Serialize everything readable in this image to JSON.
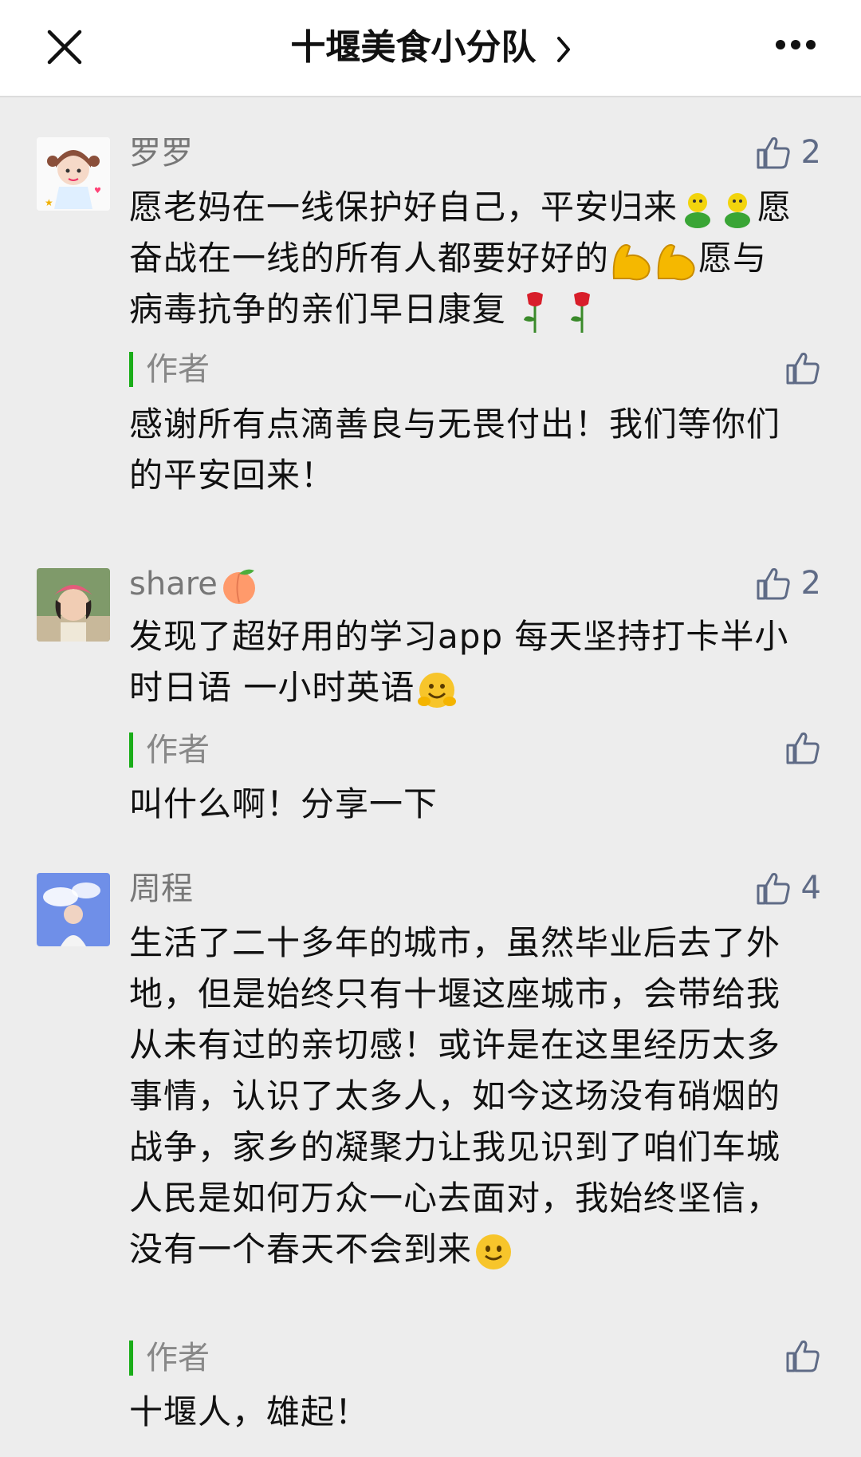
{
  "nav": {
    "title": "十堰美食小分队",
    "close_icon": "close-icon",
    "more_icon": "more-icon"
  },
  "comments": [
    {
      "nickname": "罗罗",
      "likes": "2",
      "text_segments": [
        "愿老妈在一线保护好自己，平安归来",
        "愿奋战在一线的所有人都要好好的",
        "愿与病毒抗争的亲们早日康复"
      ],
      "reply_label": "作者",
      "reply": "感谢所有点滴善良与无畏付出！我们等你们的平安回来！"
    },
    {
      "nickname": "share",
      "likes": "2",
      "text": "发现了超好用的学习app  每天坚持打卡半小时日语 一小时英语",
      "reply_label": "作者",
      "reply": "叫什么啊！分享一下"
    },
    {
      "nickname": "周程",
      "likes": "4",
      "text": "生活了二十多年的城市，虽然毕业后去了外地，但是始终只有十堰这座城市，会带给我从未有过的亲切感！或许是在这里经历太多事情，认识了太多人，如今这场没有硝烟的战争，家乡的凝聚力让我见识到了咱们车城人民是如何万众一心去面对，我始终坚信，没有一个春天不会到来",
      "reply_label": "作者",
      "reply": "十堰人，雄起！"
    }
  ],
  "colors": {
    "accent_green": "#1aad19",
    "like_blue": "#5f6b86",
    "background": "#ededed"
  }
}
